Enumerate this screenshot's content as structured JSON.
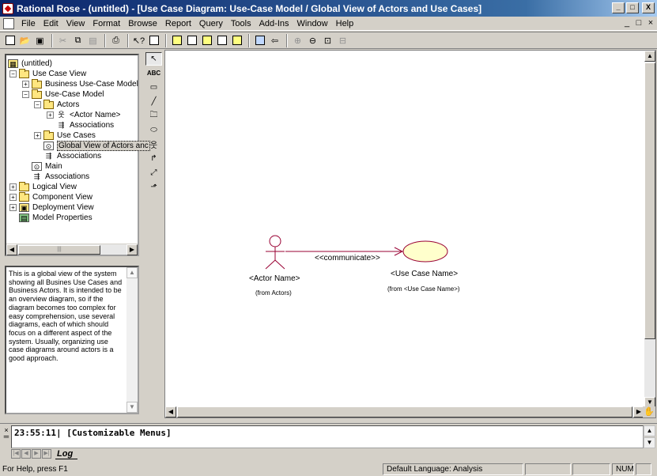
{
  "window": {
    "title": "Rational Rose - (untitled) - [Use Case Diagram: Use-Case Model / Global View of Actors and Use Cases]",
    "buttons": {
      "minimize": "_",
      "maximize": "□",
      "close": "X"
    }
  },
  "menubar": {
    "items": [
      {
        "label": "File",
        "key": "F"
      },
      {
        "label": "Edit",
        "key": "E"
      },
      {
        "label": "View",
        "key": "V"
      },
      {
        "label": "Format",
        "key": "o"
      },
      {
        "label": "Browse",
        "key": "B"
      },
      {
        "label": "Report",
        "key": "R"
      },
      {
        "label": "Query",
        "key": "Q"
      },
      {
        "label": "Tools",
        "key": "T"
      },
      {
        "label": "Add-Ins",
        "key": "A"
      },
      {
        "label": "Window",
        "key": "W"
      },
      {
        "label": "Help",
        "key": "H"
      }
    ],
    "mdi_buttons": [
      "_",
      "□",
      "×"
    ]
  },
  "browser": {
    "items": [
      {
        "label": "(untitled)",
        "icon": "model-root-icon"
      },
      {
        "label": "Use Case View",
        "icon": "folder-icon",
        "toggle": "−"
      },
      {
        "label": "Business Use-Case Model",
        "icon": "folder-icon",
        "toggle": "+"
      },
      {
        "label": "Use-Case Model",
        "icon": "folder-icon",
        "toggle": "−"
      },
      {
        "label": "Actors",
        "icon": "folder-icon",
        "toggle": "−"
      },
      {
        "label": "<Actor Name>",
        "icon": "actor-icon",
        "toggle": "+"
      },
      {
        "label": "Associations",
        "icon": "associations-icon"
      },
      {
        "label": "Use Cases",
        "icon": "folder-icon",
        "toggle": "+"
      },
      {
        "label": "Global View of Actors anc",
        "icon": "diagram-icon",
        "selected": true
      },
      {
        "label": "Associations",
        "icon": "associations-icon"
      },
      {
        "label": "Main",
        "icon": "diagram-icon"
      },
      {
        "label": "Associations",
        "icon": "associations-icon"
      },
      {
        "label": "Logical View",
        "icon": "folder-icon",
        "toggle": "+"
      },
      {
        "label": "Component View",
        "icon": "folder-icon",
        "toggle": "+"
      },
      {
        "label": "Deployment View",
        "icon": "deployment-icon",
        "toggle": "+"
      },
      {
        "label": "Model Properties",
        "icon": "properties-icon"
      }
    ]
  },
  "documentation": {
    "text": "This is a global view of the system showing all Busines Use Cases and Business Actors.  It is intended to be an overview diagram, so if the diagram becomes too complex for easy comprehension, use several diagrams, each of which should focus on a different aspect of the system. Usually, organizing use case diagrams around actors is a good approach."
  },
  "palette": {
    "text_tool": "ABC"
  },
  "diagram": {
    "actor": {
      "name": "<Actor Name>",
      "from": "(from Actors)"
    },
    "use_case": {
      "name": "<Use Case Name>",
      "from": "(from <Use Case Name>)"
    },
    "association": {
      "stereotype": "<<communicate>>"
    },
    "colors": {
      "actor_stroke": "#990033",
      "use_case_fill": "#ffffcc",
      "use_case_stroke": "#990033"
    }
  },
  "log": {
    "entry": "23:55:11|  [Customizable Menus]",
    "tab": "Log"
  },
  "statusbar": {
    "help": "For Help, press F1",
    "language": "Default Language: Analysis",
    "num": "NUM"
  }
}
